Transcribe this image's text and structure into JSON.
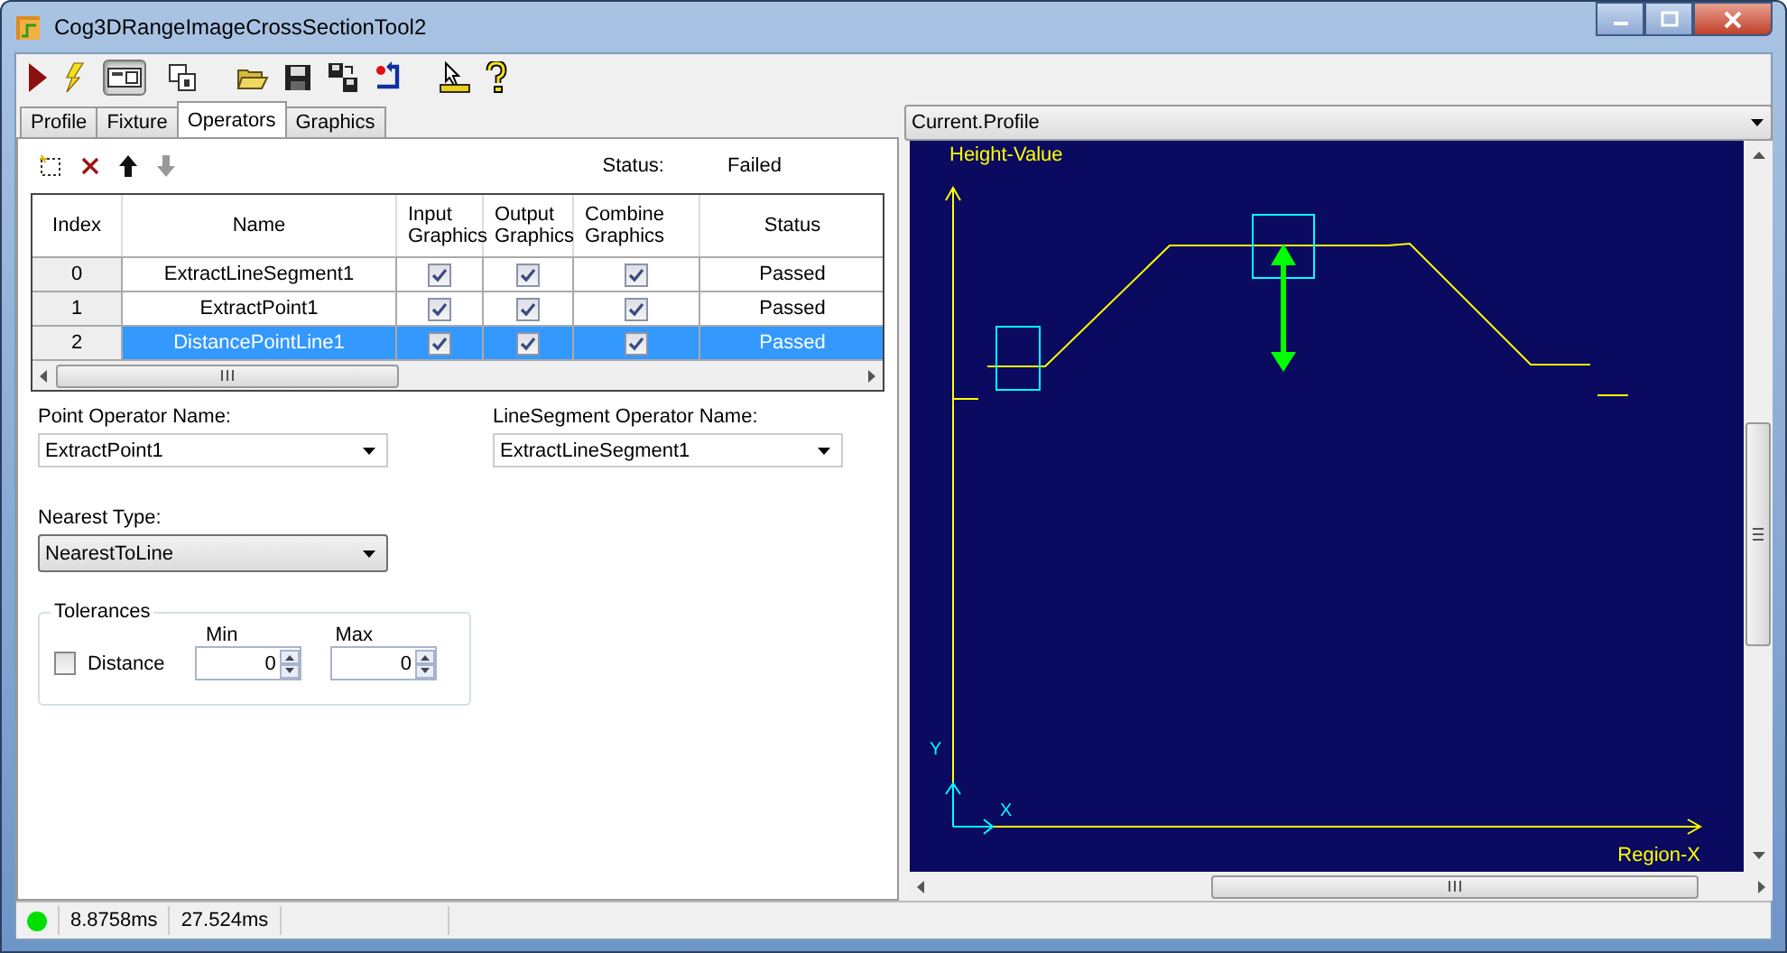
{
  "window": {
    "title": "Cog3DRangeImageCrossSectionTool2"
  },
  "toolbar": {
    "toggles": [
      {
        "selected": true
      },
      {
        "selected": false
      }
    ]
  },
  "tabs": [
    {
      "label": "Profile",
      "selected": false
    },
    {
      "label": "Fixture",
      "selected": false
    },
    {
      "label": "Operators",
      "selected": true
    },
    {
      "label": "Graphics",
      "selected": false
    }
  ],
  "operators_toolbar": {
    "status_label": "Status:",
    "status_value": "Failed"
  },
  "table": {
    "columns": [
      "Index",
      "Name",
      "Input Graphics",
      "Output Graphics",
      "Combine Graphics",
      "Status"
    ],
    "rows": [
      {
        "index": "0",
        "name": "ExtractLineSegment1",
        "input_graphics": true,
        "output_graphics": true,
        "combine_graphics": true,
        "status": "Passed",
        "selected": false
      },
      {
        "index": "1",
        "name": "ExtractPoint1",
        "input_graphics": true,
        "output_graphics": true,
        "combine_graphics": true,
        "status": "Passed",
        "selected": false
      },
      {
        "index": "2",
        "name": "DistancePointLine1",
        "input_graphics": true,
        "output_graphics": true,
        "combine_graphics": true,
        "status": "Passed",
        "selected": true
      }
    ]
  },
  "form": {
    "point_operator": {
      "label": "Point Operator Name:",
      "value": "ExtractPoint1"
    },
    "linesegment_operator": {
      "label": "LineSegment Operator Name:",
      "value": "ExtractLineSegment1"
    },
    "nearest_type": {
      "label": "Nearest Type:",
      "value": "NearestToLine"
    },
    "tolerances": {
      "title": "Tolerances",
      "min_label": "Min",
      "max_label": "Max",
      "rows": [
        {
          "label": "Distance",
          "checked": false,
          "min": "0",
          "max": "0"
        }
      ]
    }
  },
  "plot": {
    "selector": "Current.Profile",
    "y_label": "Height-Value",
    "x_label": "Region-X",
    "x_marker": "X",
    "y_marker": "Y"
  },
  "status_bar": {
    "ok": true,
    "times": [
      "8.8758ms",
      "27.524ms"
    ]
  }
}
